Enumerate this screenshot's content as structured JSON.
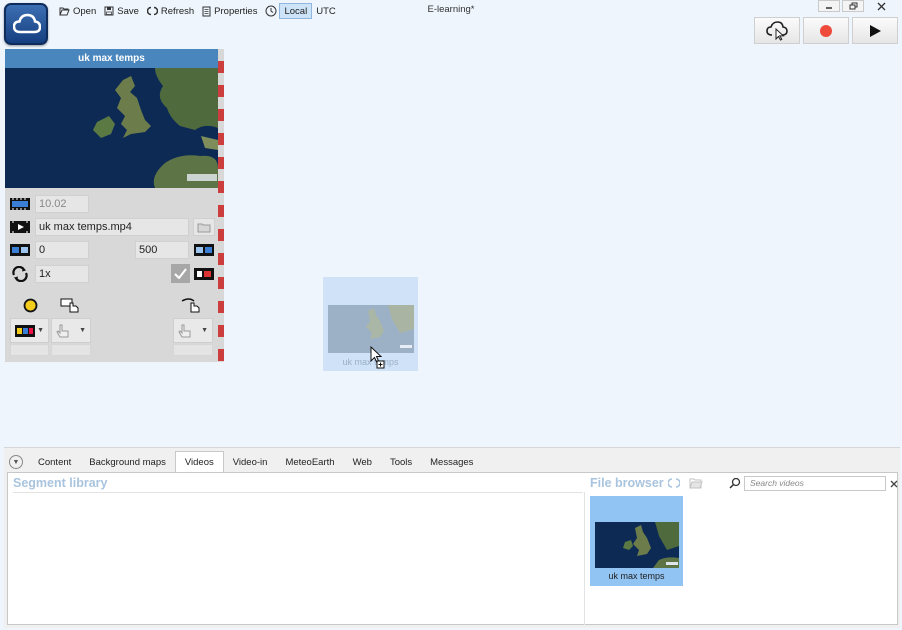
{
  "window": {
    "title": "E-learning*"
  },
  "toolbar": {
    "open_label": "Open",
    "save_label": "Save",
    "refresh_label": "Refresh",
    "properties_label": "Properties",
    "local_label": "Local",
    "utc_label": "UTC"
  },
  "clip": {
    "title": "uk max temps",
    "duration": "10.02",
    "filename": "uk max temps.mp4",
    "start_frame": "0",
    "end_frame": "500",
    "speed": "1x",
    "loop_checked": true
  },
  "drag_ghost": {
    "label": "uk max temps"
  },
  "dock": {
    "tabs": [
      {
        "label": "Content"
      },
      {
        "label": "Background maps"
      },
      {
        "label": "Videos"
      },
      {
        "label": "Video-in"
      },
      {
        "label": "MeteoEarth"
      },
      {
        "label": "Web"
      },
      {
        "label": "Tools"
      },
      {
        "label": "Messages"
      }
    ],
    "active_tab": "Videos",
    "segment_library_title": "Segment library",
    "file_browser_title": "File browser",
    "search_placeholder": "Search videos",
    "files": [
      {
        "name": "uk max temps"
      }
    ]
  },
  "icons": {
    "logo": "cloud-icon",
    "open": "open-folder-icon",
    "save": "save-disk-icon",
    "refresh": "refresh-icon",
    "properties": "properties-icon",
    "clock": "clock-icon",
    "cloud_upload": "cloud-pointer-icon",
    "record": "record-icon",
    "play": "play-icon"
  },
  "colors": {
    "accent": "#4a86be",
    "record": "#ef4b3c",
    "selection": "#91c3f3",
    "stripe": "#cc3d3d"
  }
}
